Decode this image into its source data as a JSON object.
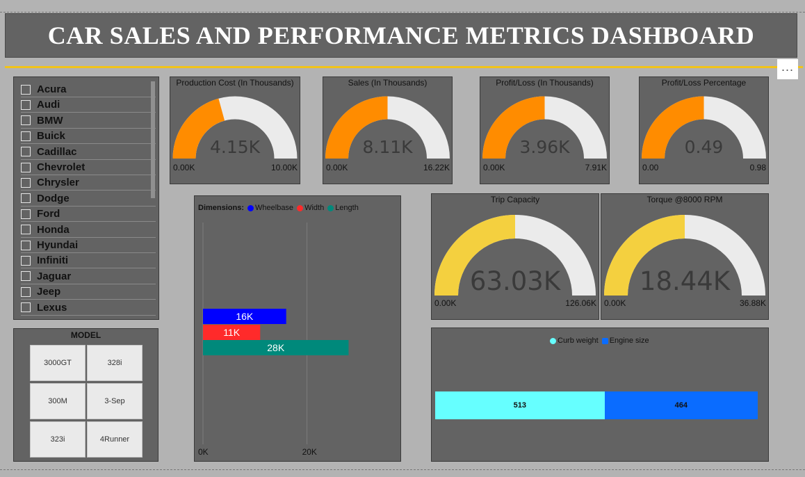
{
  "title": "CAR SALES AND PERFORMANCE METRICS DASHBOARD",
  "more_button": "...",
  "slicer": {
    "items": [
      "Acura",
      "Audi",
      "BMW",
      "Buick",
      "Cadillac",
      "Chevrolet",
      "Chrysler",
      "Dodge",
      "Ford",
      "Honda",
      "Hyundai",
      "Infiniti",
      "Jaguar",
      "Jeep",
      "Lexus"
    ]
  },
  "model": {
    "title": "MODEL",
    "tiles": [
      "3000GT",
      "328i",
      "300M",
      "3-Sep",
      "323i",
      "4Runner"
    ]
  },
  "gauges": [
    {
      "title": "Production Cost (In Thousands)",
      "value": "4.15K",
      "min": "0.00K",
      "max": "10.00K",
      "fraction": 0.415,
      "color": "#ff8c00"
    },
    {
      "title": "Sales (In Thousands)",
      "value": "8.11K",
      "min": "0.00K",
      "max": "16.22K",
      "fraction": 0.5,
      "color": "#ff8c00"
    },
    {
      "title": "Profit/Loss (In Thousands)",
      "value": "3.96K",
      "min": "0.00K",
      "max": "7.91K",
      "fraction": 0.5,
      "color": "#ff8c00"
    },
    {
      "title": "Profit/Loss Percentage",
      "value": "0.49",
      "min": "0.00",
      "max": "0.98",
      "fraction": 0.5,
      "color": "#ff8c00"
    }
  ],
  "big_gauges": [
    {
      "title": "Trip Capacity",
      "value": "63.03K",
      "min": "0.00K",
      "max": "126.06K",
      "fraction": 0.5,
      "color": "#f4d03f"
    },
    {
      "title": "Torque @8000 RPM",
      "value": "18.44K",
      "min": "0.00K",
      "max": "36.88K",
      "fraction": 0.5,
      "color": "#f4d03f"
    }
  ],
  "chart_data": [
    {
      "type": "bar",
      "legend_title": "Dimensions:",
      "series": [
        {
          "name": "Wheelbase",
          "value": 16000,
          "label": "16K",
          "color": "#0000ff"
        },
        {
          "name": "Width",
          "value": 11000,
          "label": "11K",
          "color": "#ff2a2a"
        },
        {
          "name": "Length",
          "value": 28000,
          "label": "28K",
          "color": "#00897b"
        }
      ],
      "xlim": [
        0,
        36500
      ],
      "ticks": [
        {
          "value": 0,
          "label": "0K"
        },
        {
          "value": 20000,
          "label": "20K"
        }
      ],
      "grid": true
    },
    {
      "type": "bar",
      "stacked": true,
      "series": [
        {
          "name": "Curb weight",
          "value": 513,
          "label": "513",
          "color": "#66ffff"
        },
        {
          "name": "Engine size",
          "value": 464,
          "label": "464",
          "color": "#0a6cff"
        }
      ]
    }
  ]
}
